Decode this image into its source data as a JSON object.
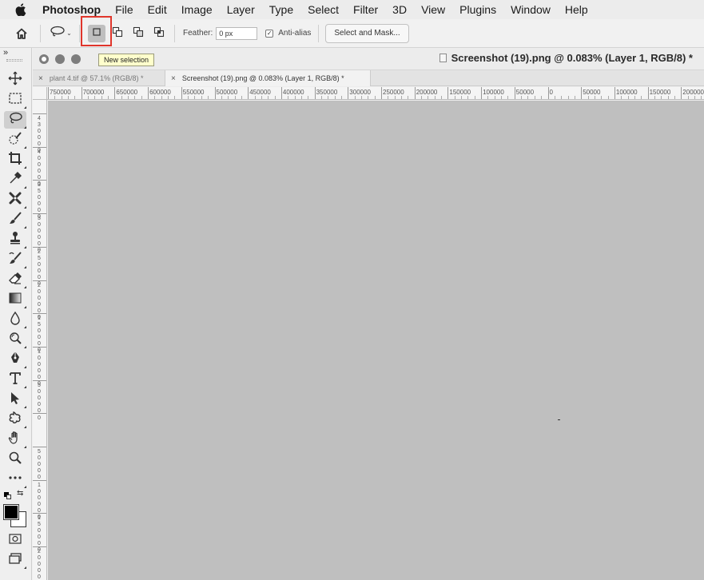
{
  "menubar": {
    "apple_icon": "apple-logo-icon",
    "app_name": "Photoshop",
    "items": [
      "File",
      "Edit",
      "Image",
      "Layer",
      "Type",
      "Select",
      "Filter",
      "3D",
      "View",
      "Plugins",
      "Window",
      "Help"
    ]
  },
  "options_bar": {
    "home_icon": "home-icon",
    "tool_icon": "lasso-icon",
    "modes": [
      {
        "name": "new-selection",
        "icon": "new-selection-icon",
        "active": true
      },
      {
        "name": "add-to-selection",
        "icon": "add-to-selection-icon",
        "active": false
      },
      {
        "name": "subtract-from-selection",
        "icon": "subtract-from-selection-icon",
        "active": false
      },
      {
        "name": "intersect-with-selection",
        "icon": "intersect-selection-icon",
        "active": false
      }
    ],
    "feather_label": "Feather:",
    "feather_value": "0 px",
    "anti_alias_label": "Anti-alias",
    "anti_alias_checked": true,
    "select_mask_label": "Select and Mask..."
  },
  "tooltip": "New selection",
  "tools": [
    "move-icon",
    "rectangular-marquee-icon",
    "lasso-icon",
    "quick-selection-icon",
    "crop-icon",
    "eyedropper-icon",
    "healing-brush-icon",
    "brush-icon",
    "clone-stamp-icon",
    "history-brush-icon",
    "eraser-icon",
    "gradient-icon",
    "blur-icon",
    "dodge-icon",
    "pen-icon",
    "type-icon",
    "path-selection-icon",
    "custom-shape-icon",
    "hand-icon",
    "zoom-icon",
    "more-tools-icon"
  ],
  "active_tool": "lasso-icon",
  "colors": {
    "foreground": "#000000",
    "background": "#ffffff",
    "canvas": "#bfbfbf",
    "highlight": "#e0352b"
  },
  "document": {
    "title": "Screenshot (19).png @ 0.083% (Layer 1, RGB/8) *",
    "tabs": [
      {
        "label": "plant 4.tif @ 57.1% (RGB/8) *",
        "active": false
      },
      {
        "label": "Screenshot (19).png @ 0.083% (Layer 1, RGB/8) *",
        "active": true
      }
    ]
  },
  "ruler_top_labels": [
    "750000",
    "700000",
    "650000",
    "600000",
    "550000",
    "500000",
    "450000",
    "400000",
    "350000",
    "300000",
    "250000",
    "200000",
    "150000",
    "100000",
    "50000",
    "0",
    "50000",
    "100000",
    "150000",
    "200000"
  ],
  "ruler_left_labels": [
    "4 3 0 0 0 0",
    "4 0 0 0 0 0",
    "3 5 0 0 0 0",
    "3 0 0 0 0 0",
    "2 5 0 0 0 0",
    "2 0 0 0 0 0",
    "1 5 0 0 0 0",
    "1 0 0 0 0 0",
    "5 0 0 0 0",
    "0",
    "5 0 0 0 0",
    "1 0 0 0 0 0",
    "1 5 0 0 0 0",
    "2 0 0 0 0 0"
  ]
}
